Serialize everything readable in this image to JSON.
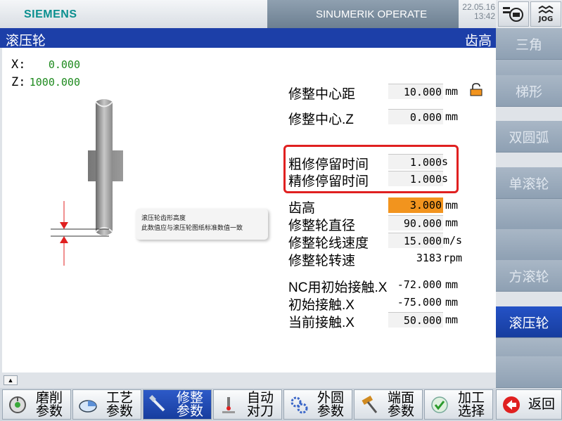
{
  "header": {
    "brand": "SIEMENS",
    "product": "SINUMERIK OPERATE",
    "date": "22.05.16",
    "time": "13:42",
    "jog_label": "JOG"
  },
  "titlebar": {
    "title": "滚压轮",
    "subtitle": "齿高"
  },
  "coords": [
    {
      "axis": "X:",
      "value": "0.000"
    },
    {
      "axis": "Z:",
      "value": "1000.000"
    }
  ],
  "callout": {
    "line1": "滚压轮齿形高度",
    "line2": "此数值应与滚压轮图纸标准数值一致"
  },
  "params": {
    "center_dist": {
      "label": "修整中心距",
      "value": "10.000",
      "unit": "mm"
    },
    "center_z": {
      "label": "修整中心.Z",
      "value": "0.000",
      "unit": "mm"
    },
    "rough_dwell": {
      "label": "粗修停留时间",
      "value": "1.000",
      "unit": "s"
    },
    "fine_dwell": {
      "label": "精修停留时间",
      "value": "1.000",
      "unit": "s"
    },
    "tooth_height": {
      "label": "齿高",
      "value": "3.000",
      "unit": "mm"
    },
    "wheel_dia": {
      "label": "修整轮直径",
      "value": "90.000",
      "unit": "mm"
    },
    "line_speed": {
      "label": "修整轮线速度",
      "value": "15.000",
      "unit": "m/s"
    },
    "rpm": {
      "label": "修整轮转速",
      "value": "3183",
      "unit": "rpm"
    },
    "nc_init": {
      "label": "NC用初始接触.X",
      "value": "-72.000",
      "unit": "mm"
    },
    "init_contact": {
      "label": "初始接触.X",
      "value": "-75.000",
      "unit": "mm"
    },
    "cur_contact": {
      "label": "当前接触.X",
      "value": "50.000",
      "unit": "mm"
    }
  },
  "right_softkeys": [
    "三角",
    "",
    "梯形",
    "双圆弧",
    "单滚轮",
    "",
    "",
    "方滚轮",
    "滚压轮",
    "",
    ""
  ],
  "bottom_softkeys": [
    {
      "l1": "磨削",
      "l2": "参数",
      "icon": "grinding-icon"
    },
    {
      "l1": "工艺",
      "l2": "参数",
      "icon": "technology-icon"
    },
    {
      "l1": "修整",
      "l2": "参数",
      "icon": "dressing-tool-icon"
    },
    {
      "l1": "自动",
      "l2": "对刀",
      "icon": "auto-probe-icon"
    },
    {
      "l1": "外圆",
      "l2": "参数",
      "icon": "gears-icon"
    },
    {
      "l1": "端面",
      "l2": "参数",
      "icon": "hammer-icon"
    },
    {
      "l1": "加工",
      "l2": "选择",
      "icon": "check-icon"
    },
    {
      "l1": "返回",
      "l2": "",
      "icon": "back-arrow-icon"
    }
  ],
  "colors": {
    "title_blue": "#1c3fa8",
    "active_field": "#f2941e",
    "highlight_frame": "#e02020",
    "coord_green": "#1e8a1e"
  }
}
